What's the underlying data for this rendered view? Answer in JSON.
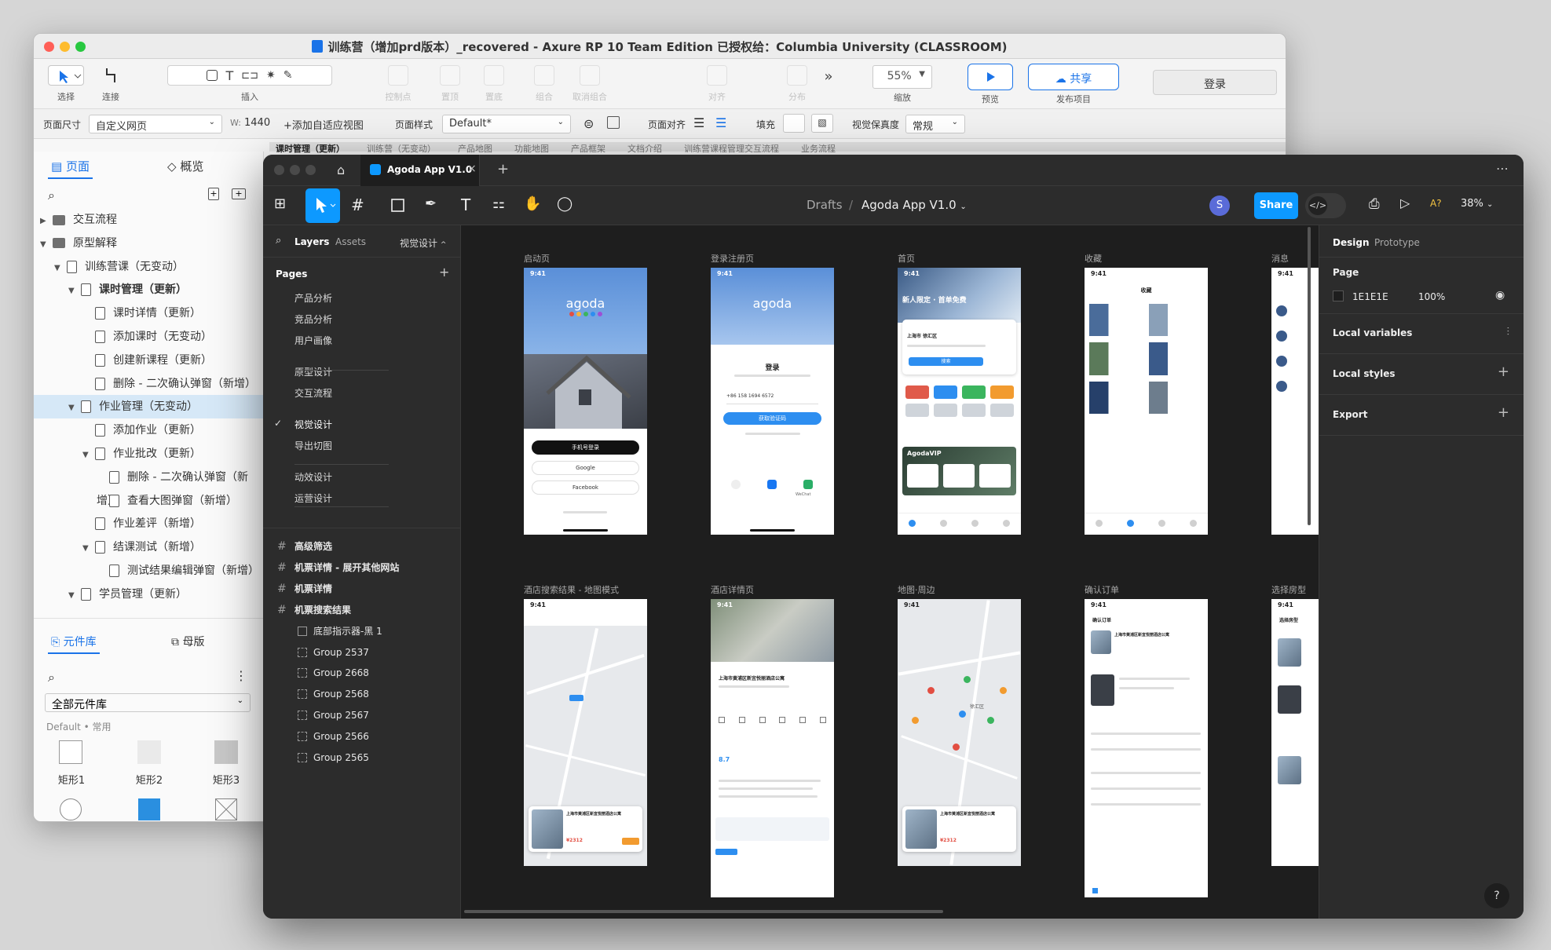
{
  "axure": {
    "title": "训练营（增加prd版本）_recovered - Axure RP 10 Team Edition 已授权给：Columbia University (CLASSROOM)",
    "toolbar": {
      "select": "选择",
      "connect": "连接",
      "insert": "插入",
      "control_points": "控制点",
      "top": "置顶",
      "bottom": "置底",
      "group": "组合",
      "ungroup": "取消组合",
      "align": "对齐",
      "distribute": "分布",
      "zoom_value": "55%",
      "zoom": "缩放",
      "preview": "预览",
      "share": "共享",
      "publish": "发布项目",
      "login": "登录"
    },
    "style_bar": {
      "page_size_label": "页面尺寸",
      "page_size_value": "自定义网页",
      "w_label": "W:",
      "w_value": "1440",
      "add_adaptive": "+添加自适应视图",
      "page_style_label": "页面样式",
      "page_style_value": "Default*",
      "page_align_label": "页面对齐",
      "fill_label": "填充",
      "fidelity_label": "视觉保真度",
      "fidelity_value": "常规"
    },
    "doc_tabs": [
      "课时管理（更新）",
      "训练营（无变动）",
      "产品地图",
      "功能地图",
      "产品框架",
      "文档介绍",
      "训练营课程管理交互流程",
      "业务流程"
    ],
    "pages_tab": "页面",
    "overview_tab": "概览",
    "tree": [
      {
        "label": "交互流程",
        "level": 0,
        "type": "folder",
        "expand": "closed"
      },
      {
        "label": "原型解释",
        "level": 0,
        "type": "folder",
        "expand": "open"
      },
      {
        "label": "训练营课（无变动）",
        "level": 1,
        "type": "page",
        "expand": "open"
      },
      {
        "label": "课时管理（更新）",
        "level": 2,
        "type": "page",
        "expand": "open",
        "bold": true
      },
      {
        "label": "课时详情（更新）",
        "level": 3,
        "type": "page",
        "expand": "none"
      },
      {
        "label": "添加课时（无变动）",
        "level": 3,
        "type": "page",
        "expand": "none"
      },
      {
        "label": "创建新课程（更新）",
        "level": 3,
        "type": "page",
        "expand": "none"
      },
      {
        "label": "删除 - 二次确认弹窗（新增）",
        "level": 3,
        "type": "page",
        "expand": "none"
      },
      {
        "label": "作业管理（无变动）",
        "level": 2,
        "type": "page",
        "expand": "open",
        "selected": true
      },
      {
        "label": "添加作业（更新）",
        "level": 3,
        "type": "page",
        "expand": "none"
      },
      {
        "label": "作业批改（更新）",
        "level": 3,
        "type": "page",
        "expand": "open"
      },
      {
        "label": "删除 - 二次确认弹窗（新增）",
        "level": 4,
        "type": "page",
        "expand": "none"
      },
      {
        "label": "查看大图弹窗（新增）",
        "level": 4,
        "type": "page",
        "expand": "none"
      },
      {
        "label": "作业差评（新增）",
        "level": 3,
        "type": "page",
        "expand": "none"
      },
      {
        "label": "结课测试（新增）",
        "level": 3,
        "type": "page",
        "expand": "open"
      },
      {
        "label": "测试结果编辑弹窗（新增）",
        "level": 4,
        "type": "page",
        "expand": "none"
      },
      {
        "label": "学员管理（更新）",
        "level": 2,
        "type": "page",
        "expand": "open"
      }
    ],
    "library_tab": "元件库",
    "masters_tab": "母版",
    "library_select": "全部元件库",
    "library_group": "Default • 常用",
    "widgets": [
      "矩形1",
      "矩形2",
      "矩形3"
    ]
  },
  "figma": {
    "tab_title": "Agoda App V1.0",
    "breadcrumb_root": "Drafts",
    "breadcrumb_file": "Agoda App V1.0",
    "avatar": "S",
    "share": "Share",
    "zoom": "38%",
    "a_badge": "A?",
    "left": {
      "layers_tab": "Layers",
      "assets_tab": "Assets",
      "page_switch": "视觉设计",
      "pages_title": "Pages",
      "pages": [
        {
          "label": "产品分析",
          "check": ""
        },
        {
          "label": "竞品分析",
          "check": ""
        },
        {
          "label": "用户画像",
          "check": ""
        },
        {
          "label": "原型设计",
          "check": ""
        },
        {
          "label": "交互流程",
          "check": ""
        },
        {
          "label": "视觉设计",
          "check": "✓"
        },
        {
          "label": "导出切图",
          "check": ""
        },
        {
          "label": "动效设计",
          "check": ""
        },
        {
          "label": "运营设计",
          "check": ""
        }
      ],
      "layers": [
        {
          "label": "高级筛选",
          "type": "hash"
        },
        {
          "label": "机票详情 - 展开其他网站",
          "type": "hash"
        },
        {
          "label": "机票详情",
          "type": "hash"
        },
        {
          "label": "机票搜索结果",
          "type": "hash"
        },
        {
          "label": "底部指示器-黑 1",
          "type": "frame"
        },
        {
          "label": "Group 2537",
          "type": "group"
        },
        {
          "label": "Group 2668",
          "type": "group"
        },
        {
          "label": "Group 2568",
          "type": "group"
        },
        {
          "label": "Group 2567",
          "type": "group"
        },
        {
          "label": "Group 2566",
          "type": "group"
        },
        {
          "label": "Group 2565",
          "type": "group"
        }
      ]
    },
    "frames_row1": [
      "启动页",
      "登录注册页",
      "首页",
      "收藏",
      "消息"
    ],
    "frames_row2": [
      "酒店搜索结果 - 地图模式",
      "酒店详情页",
      "地图·周边",
      "确认订单",
      "选择房型"
    ],
    "screen_text": {
      "time": "9:41",
      "brand": "agoda",
      "phone_login": "手机号登录",
      "google": "Google",
      "facebook": "Facebook",
      "login": "登录",
      "phone_number": "+86  158 1694 6572",
      "get_code": "获取验证码",
      "wechat": "WeChat",
      "home_banner": "新人限定 · 首单免费",
      "search": "搜索",
      "city": "上海市 徐汇区",
      "vip": "AgodaVIP",
      "favorites": "收藏",
      "hotel_name": "上海市黄浦区新宜悦丽酒店公寓",
      "price": "¥2312",
      "district": "徐汇区",
      "confirm_order": "确认订单",
      "select_room": "选择房型",
      "rating": "8.7"
    },
    "right": {
      "design_tab": "Design",
      "prototype_tab": "Prototype",
      "page_title": "Page",
      "bg_color": "1E1E1E",
      "bg_opacity": "100%",
      "local_variables": "Local variables",
      "local_styles": "Local styles",
      "export": "Export",
      "help": "?"
    }
  },
  "colors": {
    "figma_blue": "#0d99ff",
    "axure_blue": "#1a73e8",
    "agoda_blue": "#2d8ef0"
  }
}
